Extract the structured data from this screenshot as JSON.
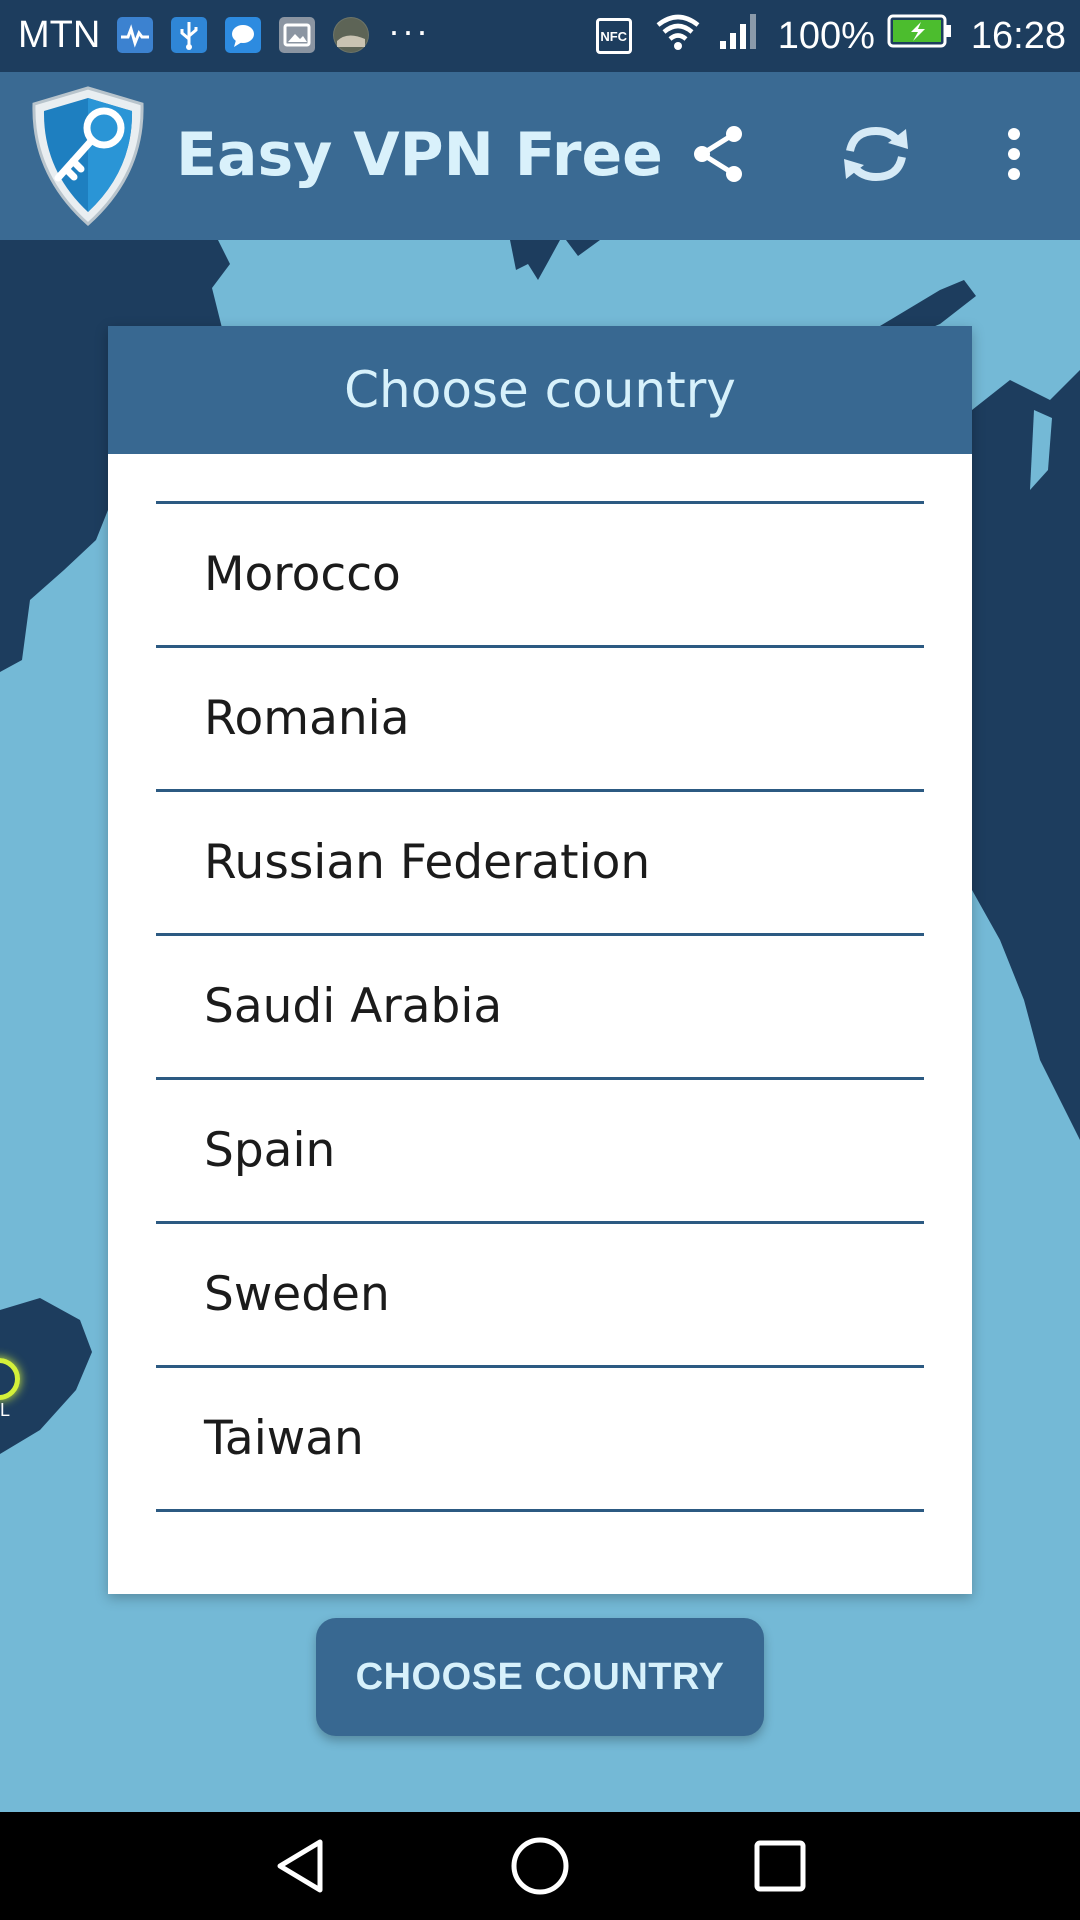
{
  "status_bar": {
    "carrier": "MTN",
    "more_indicator": "···",
    "nfc_label": "NFC",
    "battery_percent": "100%",
    "time": "16:28",
    "icons": [
      "heart-monitor-icon",
      "usb-icon",
      "message-icon",
      "gallery-icon",
      "photo-thumbnail-icon",
      "nfc-icon",
      "wifi-icon",
      "signal-icon",
      "battery-charging-icon"
    ]
  },
  "app_bar": {
    "title": "Easy VPN Free",
    "icons": [
      "shield-key-logo",
      "share-icon",
      "refresh-icon",
      "overflow-menu-icon"
    ]
  },
  "dialog": {
    "title": "Choose country",
    "countries": [
      "Morocco",
      "Romania",
      "Russian Federation",
      "Saudi Arabia",
      "Spain",
      "Sweden",
      "Taiwan"
    ]
  },
  "map_marker_label": "L",
  "button": {
    "label": "CHOOSE COUNTRY"
  },
  "nav_bar": {
    "icons": [
      "back-icon",
      "home-icon",
      "recents-icon"
    ]
  },
  "colors": {
    "status_bar": "#1d3d5e",
    "app_bar": "#3a6a93",
    "ocean": "#74b9d6",
    "land": "#1d3d5e",
    "accent_text": "#d7f1fb",
    "divider": "#2c5a82",
    "marker": "#d4f13a"
  }
}
